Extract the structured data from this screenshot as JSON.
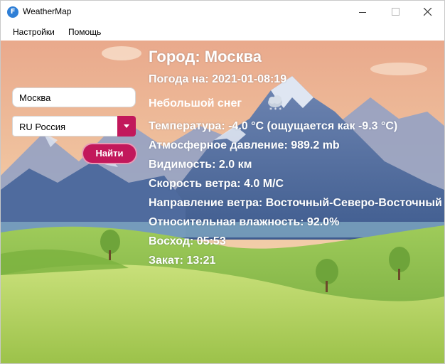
{
  "window": {
    "title": "WeatherMap",
    "app_icon_letter": "F"
  },
  "menu": {
    "items": [
      "Настройки",
      "Помощь"
    ]
  },
  "search": {
    "city_value": "Москва",
    "country_value": "RU Россия",
    "button_label": "Найти"
  },
  "weather": {
    "city": "Город: Москва",
    "date": "Погода на: 2021-01-08:19",
    "condition": "Небольшой снег",
    "condition_icon": "snow-cloud-icon",
    "temperature": "Температура: -4.0 °C (ощущается как -9.3 °C)",
    "pressure": "Атмосферное давление: 989.2 mb",
    "visibility": "Видимость: 2.0 км",
    "wind_speed": "Скорость ветра: 4.0 М/С",
    "wind_direction": "Направление ветра: Восточный-Северо-Восточный",
    "humidity": "Относительная влажность: 92.0%",
    "sunrise": "Восход: 05:53",
    "sunset": "Закат: 13:21"
  },
  "colors": {
    "accent": "#c2185b",
    "sky": "#eaa98a",
    "mountain": "#4f6b9e",
    "grass": "#8fc34a"
  }
}
